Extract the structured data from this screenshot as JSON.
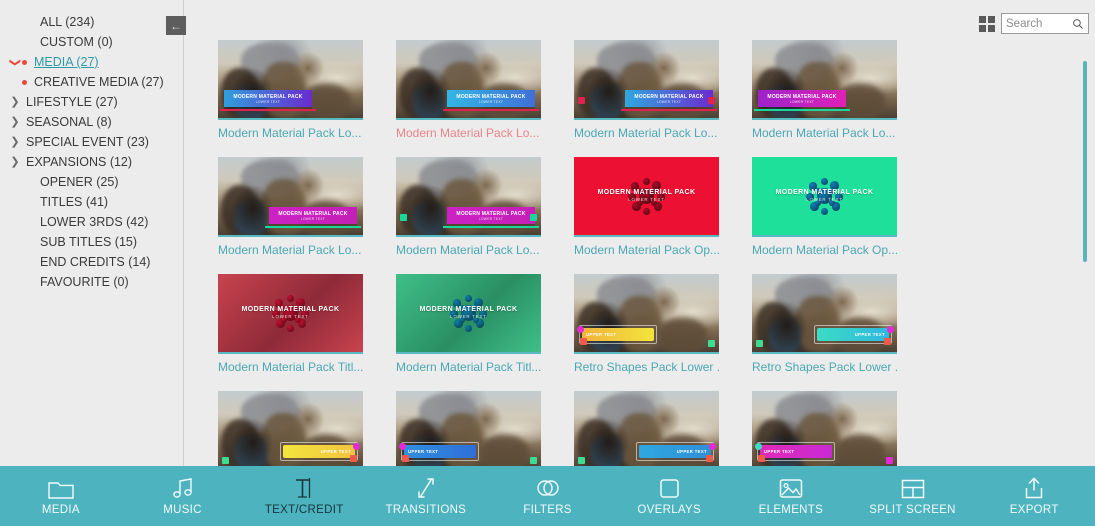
{
  "app": {
    "accent_teal": "#4db3bf",
    "caption_teal": "#4aa8b3",
    "caption_pink": "#e8848c",
    "background": "#ececec"
  },
  "collapse_button": {
    "label": "←",
    "name": "collapse-panel-button"
  },
  "toprail": {
    "grid_toggle_name": "grid-view-toggle",
    "search": {
      "placeholder": "Search",
      "value": ""
    }
  },
  "sidebar": {
    "items": [
      {
        "label": "ALL (234)",
        "indent": 0,
        "twisty": "none",
        "dot": false,
        "link": false
      },
      {
        "label": "CUSTOM (0)",
        "indent": 0,
        "twisty": "none",
        "dot": false,
        "link": false
      },
      {
        "label": "MEDIA (27)",
        "indent": 0,
        "twisty": "down",
        "dot": true,
        "link": true
      },
      {
        "label": "CREATIVE MEDIA (27)",
        "indent": 1,
        "twisty": "none",
        "dot": true,
        "link": false
      },
      {
        "label": "LIFESTYLE (27)",
        "indent": 0,
        "twisty": "right",
        "dot": false,
        "link": false
      },
      {
        "label": "SEASONAL (8)",
        "indent": 0,
        "twisty": "right",
        "dot": false,
        "link": false
      },
      {
        "label": "SPECIAL EVENT (23)",
        "indent": 0,
        "twisty": "right",
        "dot": false,
        "link": false
      },
      {
        "label": "EXPANSIONS (12)",
        "indent": 0,
        "twisty": "right",
        "dot": false,
        "link": false
      },
      {
        "label": "OPENER (25)",
        "indent": 0,
        "twisty": "none",
        "dot": false,
        "link": false
      },
      {
        "label": "TITLES (41)",
        "indent": 0,
        "twisty": "none",
        "dot": false,
        "link": false
      },
      {
        "label": "LOWER 3RDS (42)",
        "indent": 0,
        "twisty": "none",
        "dot": false,
        "link": false
      },
      {
        "label": "SUB TITLES (15)",
        "indent": 0,
        "twisty": "none",
        "dot": false,
        "link": false
      },
      {
        "label": "END CREDITS (14)",
        "indent": 0,
        "twisty": "none",
        "dot": false,
        "link": false
      },
      {
        "label": "FAVOURITE (0)",
        "indent": 0,
        "twisty": "none",
        "dot": false,
        "link": false
      }
    ]
  },
  "grid": {
    "items": [
      {
        "caption": "Modern Material Pack Lo...",
        "caption_color": "teal",
        "style": "photo-banner",
        "banner_title": "MODERN MATERIAL PACK",
        "banner_sub": "LOWER TEXT",
        "banner_from": "#2f9fdc",
        "banner_to": "#6a2bd0",
        "banner_align": "left",
        "underbar": "#e0234e",
        "chips": []
      },
      {
        "caption": "Modern Material Pack Lo...",
        "caption_color": "pink",
        "style": "photo-banner",
        "banner_title": "MODERN MATERIAL PACK",
        "banner_sub": "LOWER TEXT",
        "banner_from": "#33b7e4",
        "banner_to": "#3f6fd8",
        "banner_align": "right",
        "underbar": "#e0234e",
        "chips": []
      },
      {
        "caption": "Modern Material Pack Lo...",
        "caption_color": "teal",
        "style": "photo-banner",
        "banner_title": "MODERN MATERIAL PACK",
        "banner_sub": "LOWER TEXT",
        "banner_from": "#2fa8e0",
        "banner_to": "#6a2bd0",
        "banner_align": "right",
        "underbar": "#e0234e",
        "chips": [
          "#e0234e",
          "#e0234e"
        ]
      },
      {
        "caption": "Modern Material Pack Lo...",
        "caption_color": "teal",
        "style": "photo-banner",
        "banner_title": "MODERN MATERIAL PACK",
        "banner_sub": "LOWER TEXT",
        "banner_from": "#9b23c9",
        "banner_to": "#e021b7",
        "banner_align": "left",
        "underbar": "#19d99a",
        "chips": []
      },
      {
        "caption": "Modern Material Pack Lo...",
        "caption_color": "teal",
        "style": "photo-banner",
        "banner_title": "MODERN MATERIAL PACK",
        "banner_sub": "LOWER TEXT",
        "banner_from": "#cc22c5",
        "banner_to": "#c41fb6",
        "banner_align": "right",
        "underbar": "#19d99a",
        "chips": []
      },
      {
        "caption": "Modern Material Pack Lo...",
        "caption_color": "teal",
        "style": "photo-banner",
        "banner_title": "MODERN MATERIAL PACK",
        "banner_sub": "LOWER TEXT",
        "banner_from": "#cc22c5",
        "banner_to": "#c41fb6",
        "banner_align": "right",
        "underbar": "#19d99a",
        "chips": [
          "#19d99a",
          "#19d99a"
        ]
      },
      {
        "caption": "Modern Material Pack Op...",
        "caption_color": "teal",
        "style": "solid",
        "bg": "#ec1033",
        "blob": "#a80d26",
        "card_title": "MODERN MATERIAL PACK",
        "card_sub": "LOWER TEXT"
      },
      {
        "caption": "Modern Material Pack Op...",
        "caption_color": "teal",
        "style": "solid",
        "bg": "#1ee09a",
        "blob": "#127fb8",
        "card_title": "MODERN MATERIAL PACK",
        "card_sub": "LOWER TEXT"
      },
      {
        "caption": "Modern Material Pack Titl...",
        "caption_color": "teal",
        "style": "gradient",
        "bg": "#c9434f",
        "bg2": "#8f2a38",
        "blob": "#c41030",
        "card_title": "MODERN MATERIAL PACK",
        "card_sub": "LOWER TEXT"
      },
      {
        "caption": "Modern Material Pack Titl...",
        "caption_color": "teal",
        "style": "gradient",
        "bg": "#3fbf88",
        "bg2": "#2a8f63",
        "blob": "#0f7fa8",
        "card_title": "MODERN MATERIAL PACK",
        "card_sub": "LOWER TEXT"
      },
      {
        "caption": "Retro Shapes Pack Lower ...",
        "caption_color": "teal",
        "style": "retro",
        "retro_title": "UPPER TEXT",
        "retro_from": "#f2b33d",
        "retro_to": "#f2e53d",
        "retro_align": "left",
        "chip_a": "#e32ad6",
        "chip_b": "#f05a4a",
        "chip_c": "#3ddc91"
      },
      {
        "caption": "Retro Shapes Pack Lower ...",
        "caption_color": "teal",
        "style": "retro",
        "retro_title": "UPPER TEXT",
        "retro_from": "#3ddcc4",
        "retro_to": "#2fb7e0",
        "retro_align": "right",
        "chip_a": "#e32ad6",
        "chip_b": "#f05a4a",
        "chip_c": "#3ddc91"
      },
      {
        "caption": "",
        "caption_color": "teal",
        "style": "retro",
        "retro_title": "UPPER TEXT",
        "retro_from": "#f2e53d",
        "retro_to": "#f2c23d",
        "retro_align": "right",
        "chip_a": "#e32ad6",
        "chip_b": "#f05a4a",
        "chip_c": "#3ddc91"
      },
      {
        "caption": "",
        "caption_color": "teal",
        "style": "retro",
        "retro_title": "UPPER TEXT",
        "retro_from": "#2f8fe0",
        "retro_to": "#2f6fd8",
        "retro_align": "left",
        "chip_a": "#e32ad6",
        "chip_b": "#f05a4a",
        "chip_c": "#3ddc91"
      },
      {
        "caption": "",
        "caption_color": "teal",
        "style": "retro",
        "retro_title": "UPPER TEXT",
        "retro_from": "#2fa8e0",
        "retro_to": "#2f8fd8",
        "retro_align": "right",
        "chip_a": "#e32ad6",
        "chip_b": "#f05a4a",
        "chip_c": "#3ddc91"
      },
      {
        "caption": "",
        "caption_color": "teal",
        "style": "retro",
        "retro_title": "UPPER TEXT",
        "retro_from": "#e02ab7",
        "retro_to": "#c92ad6",
        "retro_align": "left",
        "chip_a": "#3ddcc4",
        "chip_b": "#f05a4a",
        "chip_c": "#e32ad6"
      }
    ]
  },
  "scrollbar": {
    "name": "grid-scrollbar",
    "thumb_color": "#5cb2bc"
  },
  "toolbar": {
    "items": [
      {
        "label": "MEDIA",
        "icon": "folder-icon",
        "active": false
      },
      {
        "label": "MUSIC",
        "icon": "music-note-icon",
        "active": false
      },
      {
        "label": "TEXT/CREDIT",
        "icon": "text-cursor-icon",
        "active": true
      },
      {
        "label": "TRANSITIONS",
        "icon": "transition-icon",
        "active": false
      },
      {
        "label": "FILTERS",
        "icon": "filters-icon",
        "active": false
      },
      {
        "label": "OVERLAYS",
        "icon": "square-icon",
        "active": false
      },
      {
        "label": "ELEMENTS",
        "icon": "image-icon",
        "active": false
      },
      {
        "label": "SPLIT SCREEN",
        "icon": "split-screen-icon",
        "active": false
      },
      {
        "label": "EXPORT",
        "icon": "export-icon",
        "active": false
      }
    ]
  }
}
